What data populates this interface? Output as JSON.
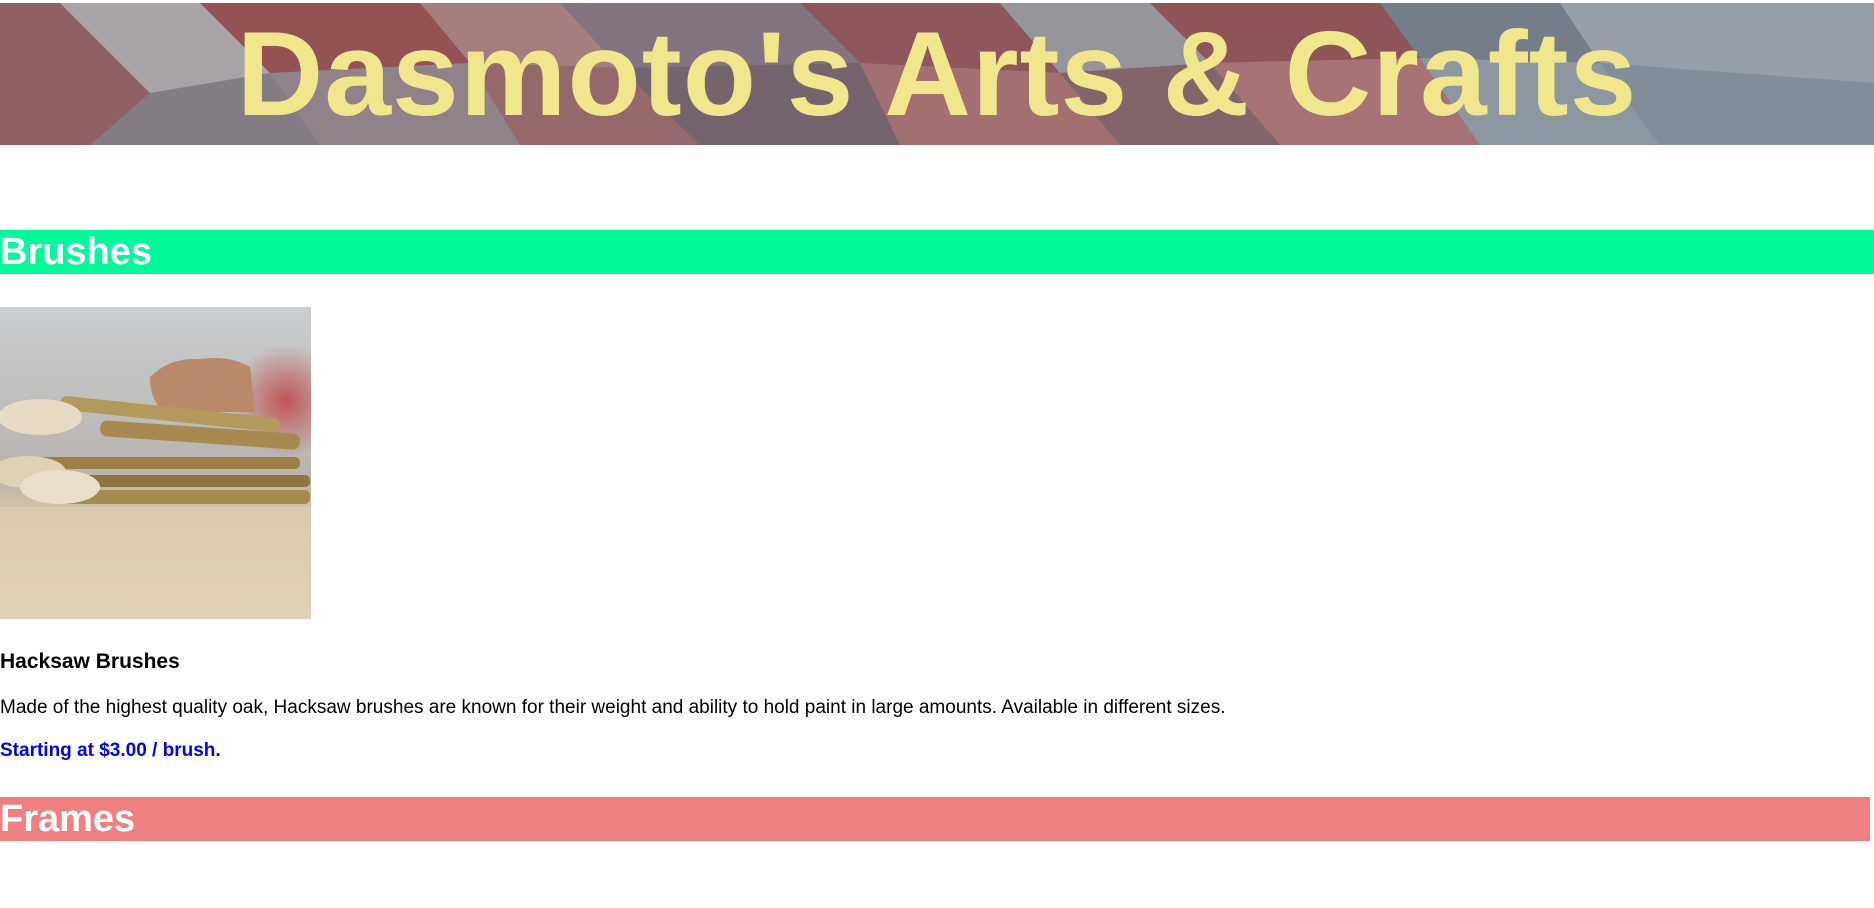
{
  "banner": {
    "title": "Dasmoto's Arts & Crafts",
    "title_color": "#f0e68c",
    "background_description_icon": "brick-pattern-image"
  },
  "sections": [
    {
      "header": "Brushes",
      "header_color": "#00fa9a",
      "product": {
        "image_icon": "paint-brushes-photo",
        "name": "Hacksaw Brushes",
        "description": "Made of the highest quality oak, Hacksaw brushes are known for their weight and ability to hold paint in large amounts. Available in different sizes.",
        "price": "Starting at $3.00 / brush.",
        "price_color": "#0000ff"
      }
    },
    {
      "header": "Frames",
      "header_color": "#f08080"
    }
  ]
}
